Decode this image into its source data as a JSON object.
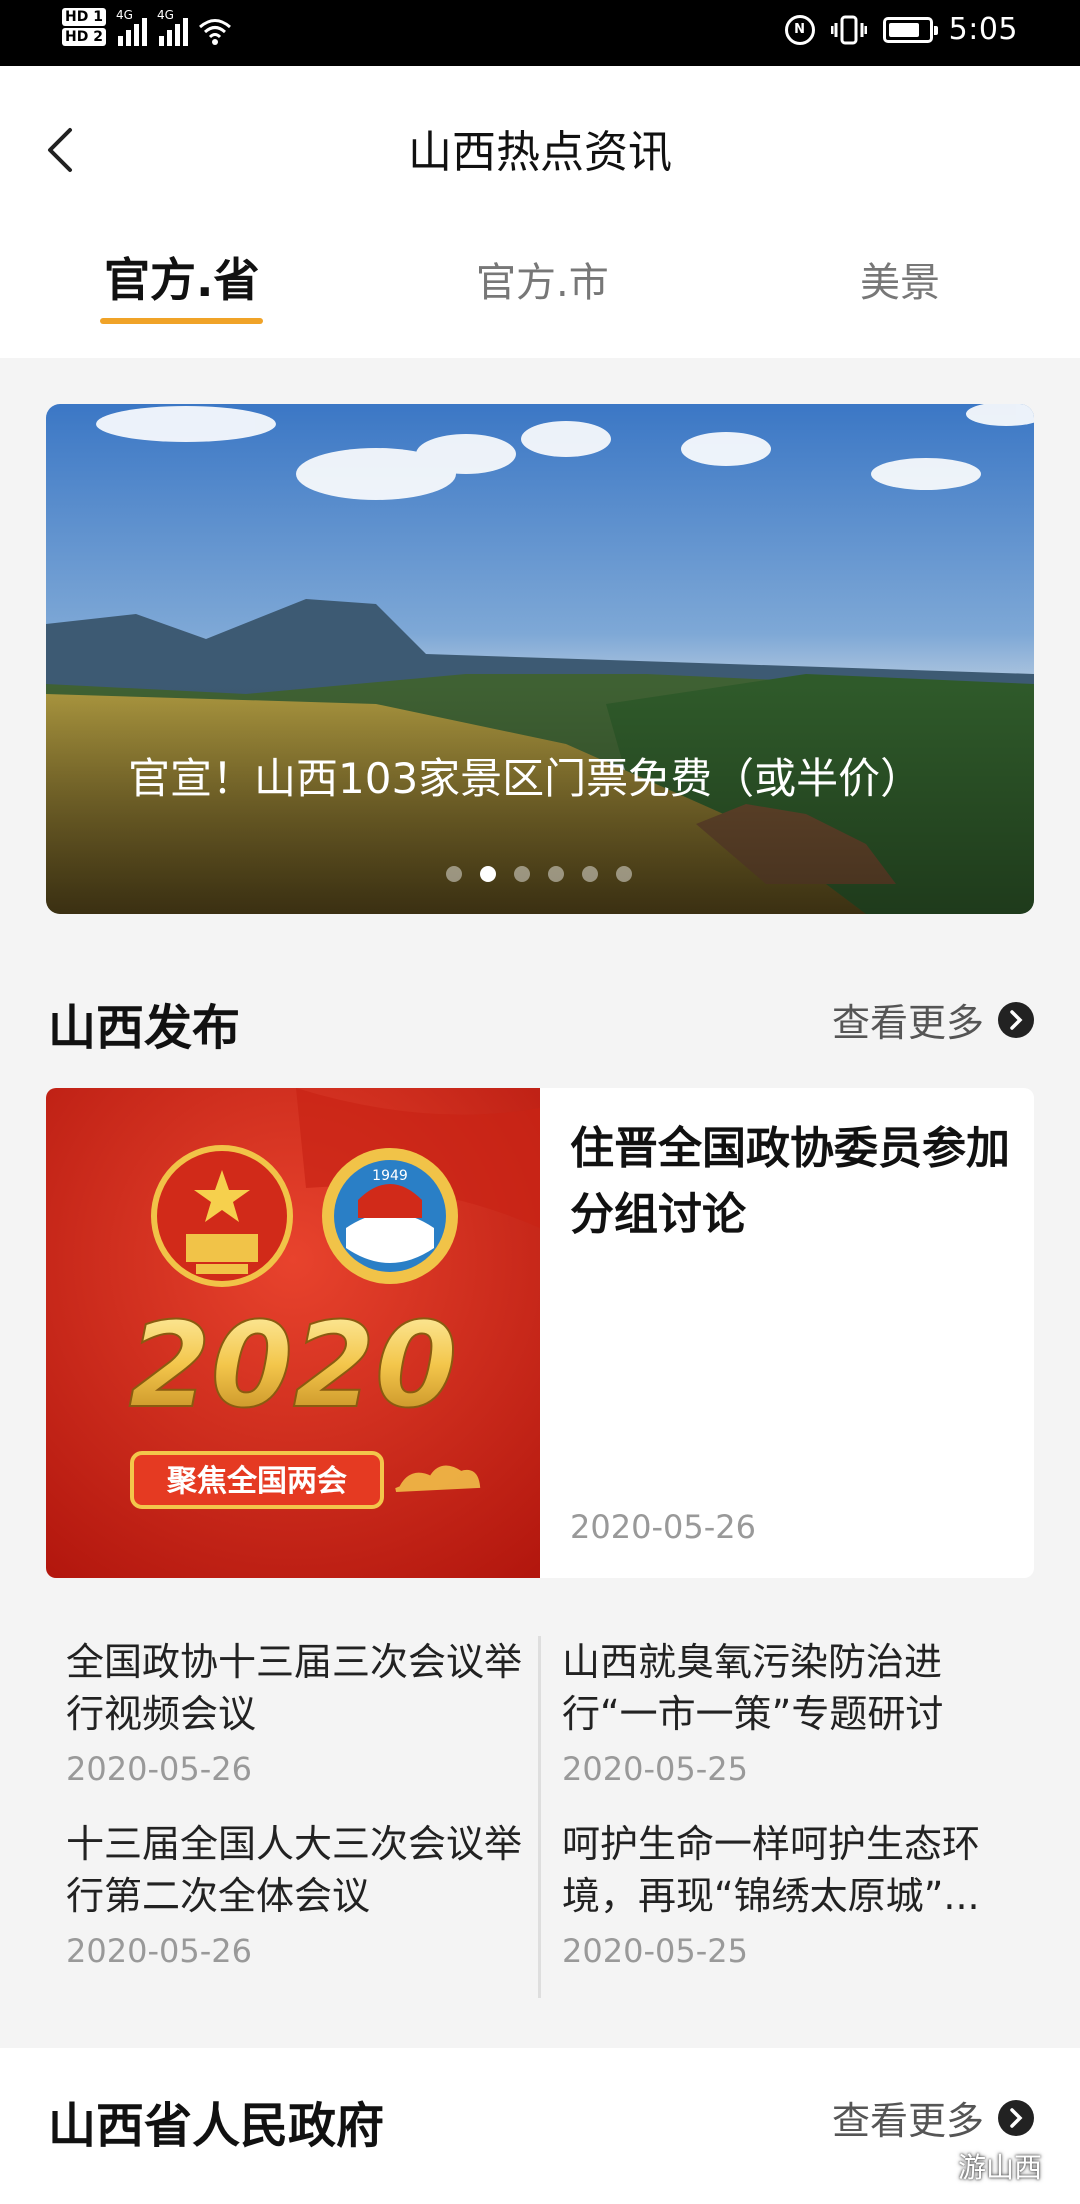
{
  "status_bar": {
    "hd1": "HD 1",
    "hd2": "HD 2",
    "net1": "4G",
    "net2": "4G",
    "nfc": "N",
    "battery_level": 0.8,
    "time": "5:05"
  },
  "header": {
    "back_icon": "chevron-left-icon",
    "title": "山西热点资讯"
  },
  "tabs": [
    {
      "label": "官方.省",
      "active": true
    },
    {
      "label": "官方.市",
      "active": false
    },
    {
      "label": "美景",
      "active": false
    }
  ],
  "banner": {
    "caption": "官宣！山西103家景区门票免费（或半价）",
    "slide_count": 6,
    "active_slide": 2
  },
  "section1": {
    "title": "山西发布",
    "more_label": "查看更多"
  },
  "feature": {
    "image_badge_year": "2020",
    "image_badge_text": "聚焦全国两会",
    "emblem_year": "1949",
    "title": "住晋全国政协委员参加分组讨论",
    "date": "2020-05-26"
  },
  "news": [
    {
      "title": "全国政协十三届三次会议举行视频会议",
      "date": "2020-05-26"
    },
    {
      "title": "山西就臭氧污染防治进行“一市一策”专题研讨",
      "date": "2020-05-25"
    },
    {
      "title": "十三届全国人大三次会议举行第二次全体会议",
      "date": "2020-05-26"
    },
    {
      "title": "呵护生命一样呵护生态环境，再现“锦绣太原城”...",
      "date": "2020-05-25"
    }
  ],
  "section2": {
    "title": "山西省人民政府",
    "more_label": "查看更多"
  },
  "watermark": "游山西",
  "colors": {
    "accent": "#f0a328",
    "feature_red": "#d42a1c",
    "gold": "#f3c64b"
  }
}
